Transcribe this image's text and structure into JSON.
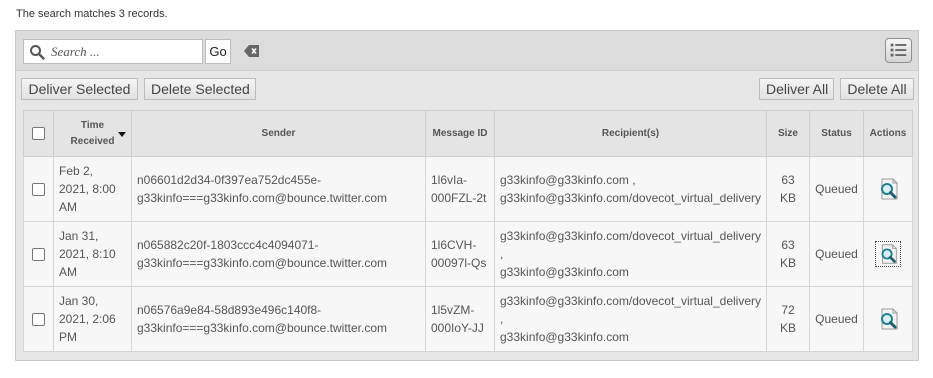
{
  "summary": "The search matches 3 records.",
  "search": {
    "placeholder": "Search ...",
    "value": "",
    "go_label": "Go"
  },
  "buttons": {
    "deliver_selected": "Deliver Selected",
    "delete_selected": "Delete Selected",
    "deliver_all": "Deliver All",
    "delete_all": "Delete All"
  },
  "columns": {
    "time_line1": "Time",
    "time_line2": "Received",
    "sender": "Sender",
    "message_id": "Message ID",
    "recipients": "Recipient(s)",
    "size": "Size",
    "status": "Status",
    "actions": "Actions"
  },
  "rows": [
    {
      "time": [
        "Feb 2,",
        "2021, 8:00",
        "AM"
      ],
      "sender": [
        "n06601d2d34-0f397ea752dc455e-",
        "g33kinfo===g33kinfo.com@bounce.twitter.com"
      ],
      "message_id": [
        "1l6vIa-",
        "000FZL-2t"
      ],
      "recipients": [
        "g33kinfo@g33kinfo.com ,",
        "g33kinfo@g33kinfo.com/dovecot_virtual_delivery"
      ],
      "size": "63 KB",
      "status": "Queued"
    },
    {
      "time": [
        "Jan 31,",
        "2021, 8:10",
        "AM"
      ],
      "sender": [
        "n065882c20f-1803ccc4c4094071-",
        "g33kinfo===g33kinfo.com@bounce.twitter.com"
      ],
      "message_id": [
        "1l6CVH-",
        "00097l-Qs"
      ],
      "recipients": [
        "g33kinfo@g33kinfo.com/dovecot_virtual_delivery",
        ",",
        "g33kinfo@g33kinfo.com"
      ],
      "size": "63 KB",
      "status": "Queued"
    },
    {
      "time": [
        "Jan 30,",
        "2021, 2:06",
        "PM"
      ],
      "sender": [
        "n06576a9e84-58d893e496c140f8-",
        "g33kinfo===g33kinfo.com@bounce.twitter.com"
      ],
      "message_id": [
        "1l5vZM-",
        "000IoY-JJ"
      ],
      "recipients": [
        "g33kinfo@g33kinfo.com/dovecot_virtual_delivery",
        ",",
        "g33kinfo@g33kinfo.com"
      ],
      "size": "72 KB",
      "status": "Queued"
    }
  ],
  "icons": {
    "search": "search-icon",
    "clear": "clear-search-icon",
    "list": "list-view-icon",
    "view": "view-message-icon",
    "sort": "sort-desc-icon"
  }
}
